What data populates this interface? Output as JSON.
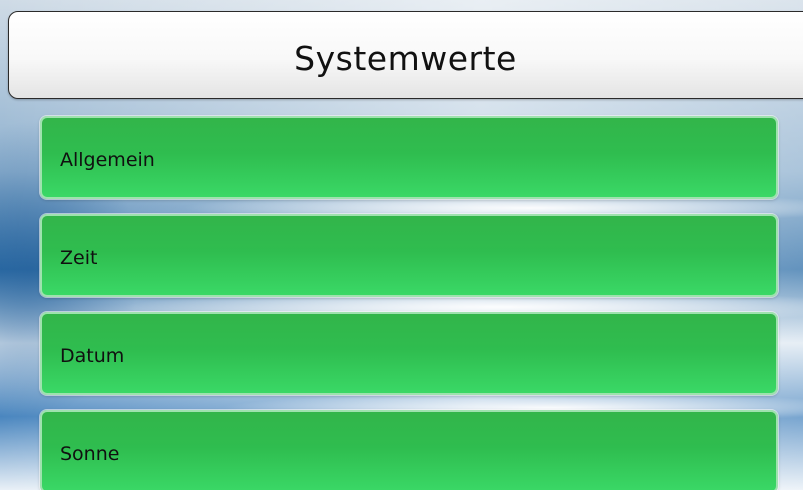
{
  "header": {
    "title": "Systemwerte"
  },
  "menu": {
    "items": [
      {
        "label": "Allgemein"
      },
      {
        "label": "Zeit"
      },
      {
        "label": "Datum"
      },
      {
        "label": "Sonne"
      }
    ]
  },
  "colors": {
    "button_green": "#2fbd4f",
    "button_border": "#9ee2ae",
    "background_blue": "#2f6fa8"
  }
}
